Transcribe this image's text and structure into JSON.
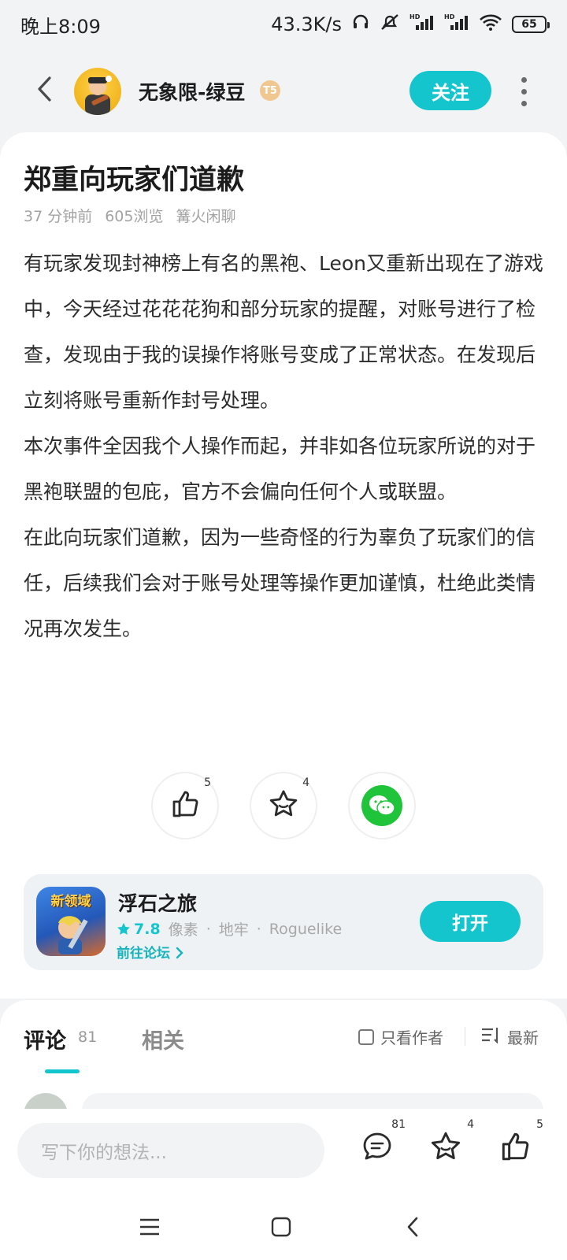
{
  "status_bar": {
    "time": "晚上8:09",
    "network_speed": "43.3K/s",
    "battery": "65",
    "icons": [
      "headphones-icon",
      "mute-icon",
      "hd-signal-icon",
      "hd-signal-icon",
      "wifi-icon",
      "battery-icon"
    ]
  },
  "header": {
    "back_icon": "back-arrow-icon",
    "author_name": "无象限-绿豆",
    "level_badge": "T5",
    "follow_label": "关注",
    "more_icon": "more-vertical-icon"
  },
  "article": {
    "title": "郑重向玩家们道歉",
    "meta": {
      "time": "37 分钟前",
      "views": "605浏览",
      "category": "篝火闲聊"
    },
    "paragraphs": [
      "有玩家发现封神榜上有名的黑袍、Leon又重新出现在了游戏中，今天经过花花花狗和部分玩家的提醒，对账号进行了检查，发现由于我的误操作将账号变成了正常状态。在发现后立刻将账号重新作封号处理。",
      "本次事件全因我个人操作而起，并非如各位玩家所说的对于黑袍联盟的包庇，官方不会偏向任何个人或联盟。",
      "在此向玩家们道歉，因为一些奇怪的行为辜负了玩家们的信任，后续我们会对于账号处理等操作更加谨慎，杜绝此类情况再次发生。"
    ],
    "actions": {
      "like_count": "5",
      "favorite_count": "4"
    }
  },
  "game_card": {
    "icon_text": "新领域",
    "name": "浮石之旅",
    "rating": "7.8",
    "tags": [
      "像素",
      "地牢",
      "Roguelike"
    ],
    "tag_separator": "·",
    "forum_link": "前往论坛",
    "open_label": "打开",
    "accent_color": "#15c5ce"
  },
  "comments": {
    "tab_comments": "评论",
    "comments_count": "81",
    "tab_related": "相关",
    "only_author_label": "只看作者",
    "sort_label": "最新"
  },
  "bottom_bar": {
    "input_placeholder": "写下你的想法...",
    "comment_count": "81",
    "favorite_count": "4",
    "like_count": "5"
  },
  "nav_bar": {
    "icons": [
      "menu-icon",
      "home-icon",
      "back-icon"
    ]
  }
}
